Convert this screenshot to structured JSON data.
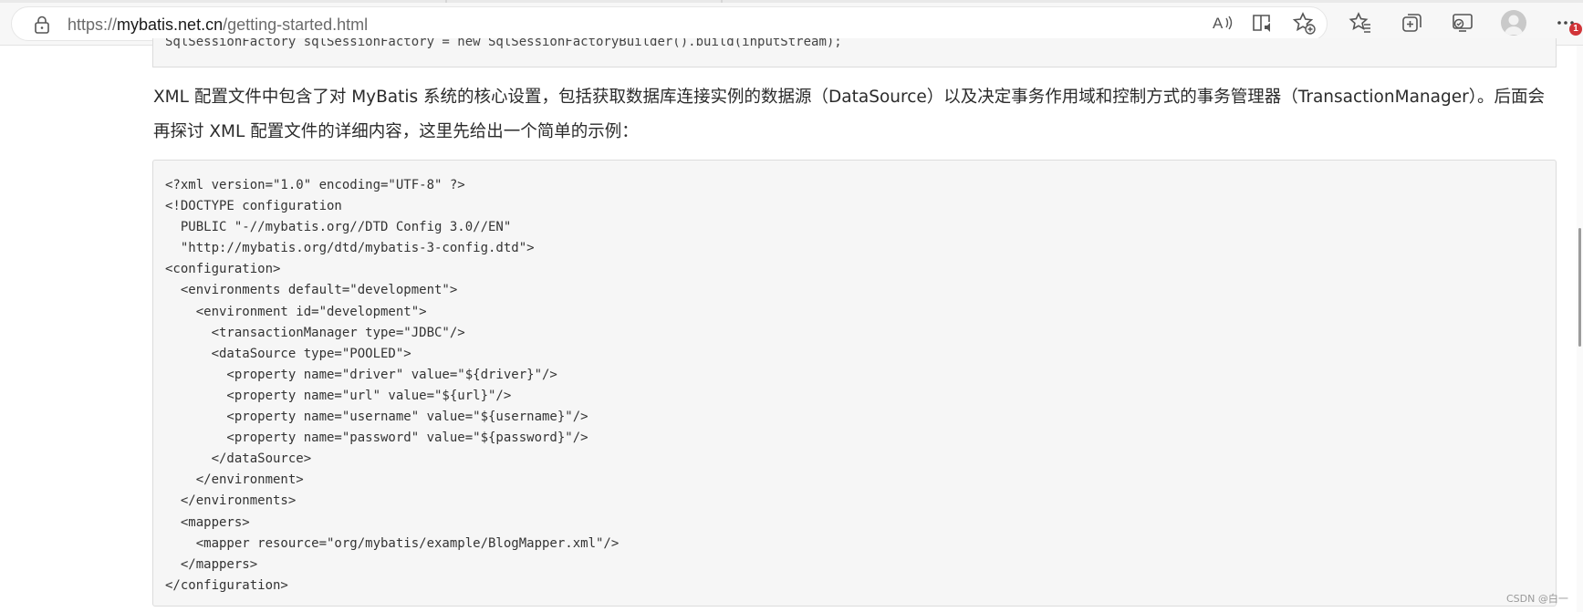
{
  "browser": {
    "url_prefix": "https://",
    "url_host": "mybatis.net.cn",
    "url_path": "/getting-started.html",
    "notification_count": "1",
    "toolbar_icons": [
      "read-aloud-icon",
      "immersive-reader-icon",
      "add-favorite-icon",
      "favorites-icon",
      "collections-icon",
      "browser-essentials-icon",
      "profile-avatar-icon",
      "more-menu-icon"
    ]
  },
  "page": {
    "prev_code_line": "SqlSessionFactory sqlSessionFactory = new SqlSessionFactoryBuilder().build(inputStream);",
    "paragraph": "XML 配置文件中包含了对 MyBatis 系统的核心设置，包括获取数据库连接实例的数据源（DataSource）以及决定事务作用域和控制方式的事务管理器（TransactionManager）。后面会再探讨 XML 配置文件的详细内容，这里先给出一个简单的示例：",
    "code_lines": [
      "<?xml version=\"1.0\" encoding=\"UTF-8\" ?>",
      "<!DOCTYPE configuration",
      "  PUBLIC \"-//mybatis.org//DTD Config 3.0//EN\"",
      "  \"http://mybatis.org/dtd/mybatis-3-config.dtd\">",
      "<configuration>",
      "  <environments default=\"development\">",
      "    <environment id=\"development\">",
      "      <transactionManager type=\"JDBC\"/>",
      "      <dataSource type=\"POOLED\">",
      "        <property name=\"driver\" value=\"${driver}\"/>",
      "        <property name=\"url\" value=\"${url}\"/>",
      "        <property name=\"username\" value=\"${username}\"/>",
      "        <property name=\"password\" value=\"${password}\"/>",
      "      </dataSource>",
      "    </environment>",
      "  </environments>",
      "  <mappers>",
      "    <mapper resource=\"org/mybatis/example/BlogMapper.xml\"/>",
      "  </mappers>",
      "</configuration>"
    ],
    "watermark": "CSDN @白一"
  },
  "colors": {
    "code_background": "#f6f6f6",
    "badge": "#d13438"
  }
}
